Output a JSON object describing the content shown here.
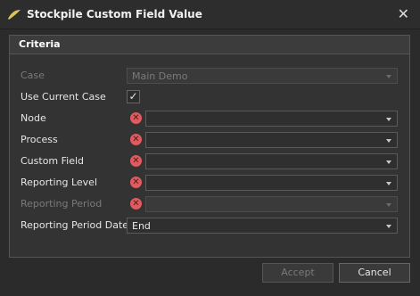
{
  "window": {
    "title": "Stockpile Custom Field Value",
    "close_glyph": "✕"
  },
  "criteria": {
    "header": "Criteria",
    "case_label": "Case",
    "case_value": "Main Demo",
    "use_current_case_label": "Use Current Case",
    "use_current_case_checked": "✓",
    "node_label": "Node",
    "process_label": "Process",
    "custom_field_label": "Custom Field",
    "reporting_level_label": "Reporting Level",
    "reporting_period_label": "Reporting Period",
    "reporting_period_date_label": "Reporting Period Date",
    "reporting_period_date_value": "End",
    "error_glyph": "✕"
  },
  "buttons": {
    "accept": "Accept",
    "cancel": "Cancel"
  },
  "colors": {
    "error": "#e05a5f",
    "accent_icon": "#d9c35a"
  }
}
